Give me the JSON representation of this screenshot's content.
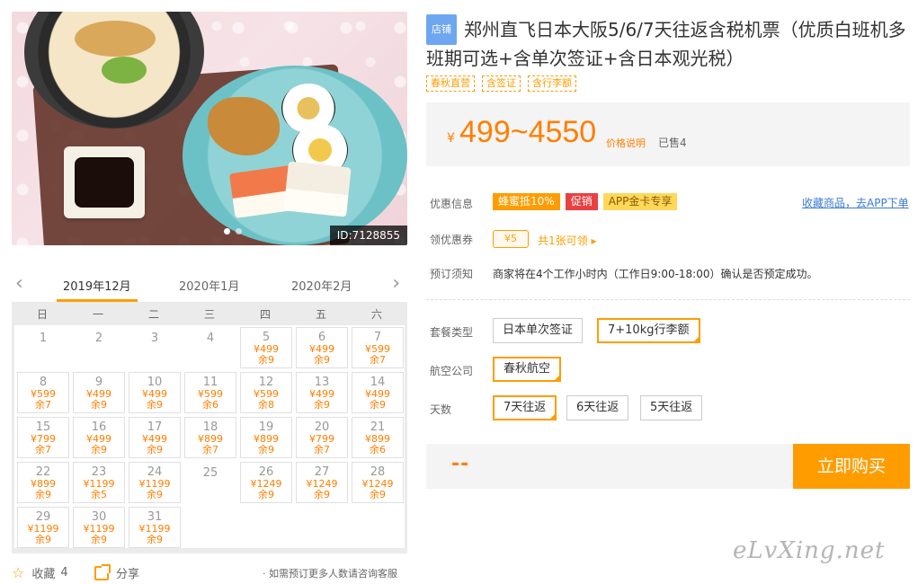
{
  "image": {
    "id_label": "ID:7128855"
  },
  "calendar": {
    "months": [
      "2019年12月",
      "2020年1月",
      "2020年2月"
    ],
    "weekdays": [
      "日",
      "一",
      "二",
      "三",
      "四",
      "五",
      "六"
    ],
    "days": [
      {
        "d": "1"
      },
      {
        "d": "2"
      },
      {
        "d": "3"
      },
      {
        "d": "4"
      },
      {
        "d": "5",
        "p": "¥499",
        "s": "余9"
      },
      {
        "d": "6",
        "p": "¥499",
        "s": "余9"
      },
      {
        "d": "7",
        "p": "¥599",
        "s": "余7"
      },
      {
        "d": "8",
        "p": "¥599",
        "s": "余7"
      },
      {
        "d": "9",
        "p": "¥499",
        "s": "余9"
      },
      {
        "d": "10",
        "p": "¥499",
        "s": "余9"
      },
      {
        "d": "11",
        "p": "¥599",
        "s": "余6"
      },
      {
        "d": "12",
        "p": "¥599",
        "s": "余8"
      },
      {
        "d": "13",
        "p": "¥499",
        "s": "余9"
      },
      {
        "d": "14",
        "p": "¥499",
        "s": "余9"
      },
      {
        "d": "15",
        "p": "¥799",
        "s": "余7"
      },
      {
        "d": "16",
        "p": "¥499",
        "s": "余9"
      },
      {
        "d": "17",
        "p": "¥499",
        "s": "余9"
      },
      {
        "d": "18",
        "p": "¥899",
        "s": "余7"
      },
      {
        "d": "19",
        "p": "¥899",
        "s": "余9"
      },
      {
        "d": "20",
        "p": "¥799",
        "s": "余7"
      },
      {
        "d": "21",
        "p": "¥899",
        "s": "余6"
      },
      {
        "d": "22",
        "p": "¥899",
        "s": "余9"
      },
      {
        "d": "23",
        "p": "¥1199",
        "s": "余5"
      },
      {
        "d": "24",
        "p": "¥1199",
        "s": "余9"
      },
      {
        "d": "25"
      },
      {
        "d": "26",
        "p": "¥1249",
        "s": "余9"
      },
      {
        "d": "27",
        "p": "¥1249",
        "s": "余9"
      },
      {
        "d": "28",
        "p": "¥1249",
        "s": "余9"
      },
      {
        "d": "29",
        "p": "¥1199",
        "s": "余9"
      },
      {
        "d": "30",
        "p": "¥1199",
        "s": "余9"
      },
      {
        "d": "31",
        "p": "¥1199",
        "s": "余9"
      }
    ]
  },
  "footer": {
    "fav_label": "收藏",
    "fav_count": "4",
    "share_label": "分享",
    "consult": "· 如需预订更多人数请咨询客服"
  },
  "product": {
    "shop_badge": "店铺",
    "title": "郑州直飞日本大阪5/6/7天往返含税机票（优质白班机多班期可选+含单次签证+含日本观光税）",
    "tags": [
      "春秋直营",
      "含签证",
      "含行李额"
    ],
    "price_symbol": "¥",
    "price": "499~4550",
    "price_desc": "价格说明",
    "sold": "已售4"
  },
  "info": {
    "promo_label": "优惠信息",
    "promos": [
      "蜂蜜抵10%",
      "促销",
      "APP金卡专享"
    ],
    "fav_link": "收藏商品，去APP下单",
    "coupon_label": "领优惠券",
    "coupon_value": "¥5",
    "coupon_more": "共1张可领 ▸",
    "notice_label": "预订须知",
    "notice": "商家将在4个工作小时内（工作日9:00-18:00）确认是否预定成功。"
  },
  "options": {
    "package_label": "套餐类型",
    "packages": [
      "日本单次签证",
      "7+10kg行李额"
    ],
    "airline_label": "航空公司",
    "airlines": [
      "春秋航空"
    ],
    "days_label": "天数",
    "days": [
      "7天往返",
      "6天往返",
      "5天往返"
    ]
  },
  "buy": {
    "placeholder": "--",
    "button": "立即购买"
  },
  "watermark": "eLvXing.net",
  "colors": {
    "accent": "#ff9d00",
    "price": "#ff7e00",
    "link": "#3a7bd5",
    "badge": "#6ea6f2"
  }
}
